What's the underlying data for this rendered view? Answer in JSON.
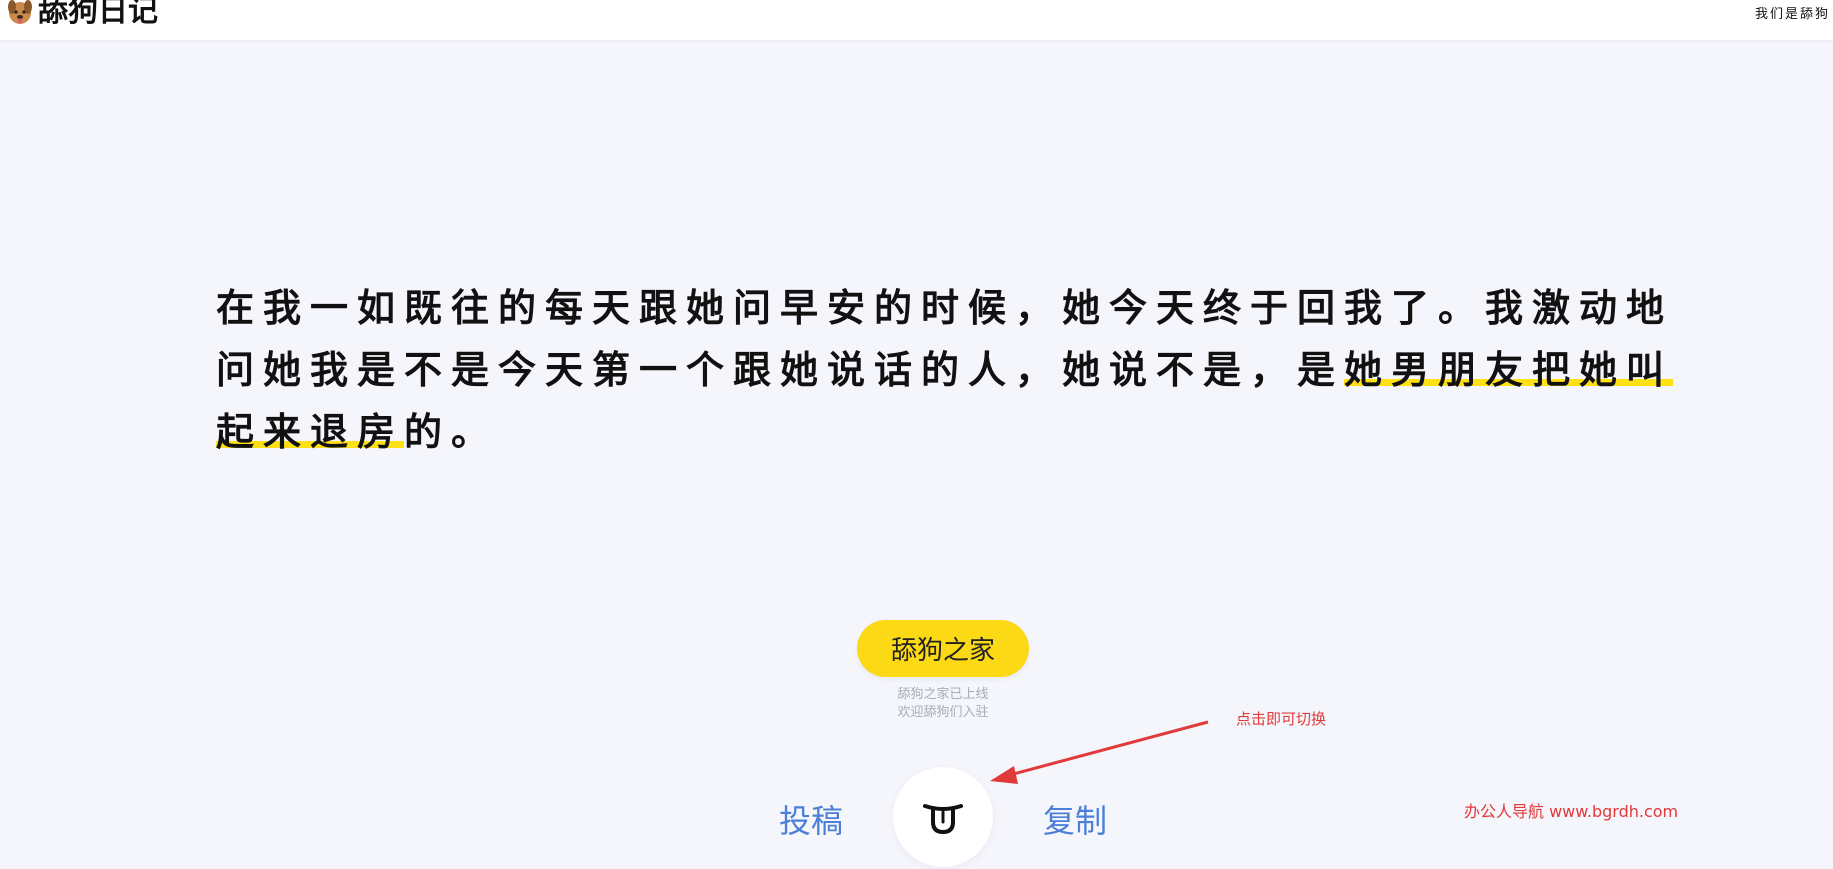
{
  "header": {
    "logo_text": "舔狗日记",
    "right_text": "我们是舔狗"
  },
  "quote": {
    "plain": "在我一如既往的每天跟她问早安的时候，她今天终于回我了。我激动地问她我是不是今天第一个跟她说话的人，她说不是，是",
    "highlighted": "她男朋友把她叫起来退房",
    "tail": "的。"
  },
  "home_button": {
    "label": "舔狗之家"
  },
  "subnote": {
    "line1": "舔狗之家已上线",
    "line2": "欢迎舔狗们入驻"
  },
  "annotation": {
    "text": "点击即可切换"
  },
  "watermark": {
    "text": "办公人导航 www.bgrdh.com"
  },
  "controls": {
    "submit_label": "投稿",
    "copy_label": "复制",
    "toggle_icon": "tongue-face-icon"
  },
  "colors": {
    "background": "#f5f5fc",
    "accent_yellow": "#fcd915",
    "link_blue": "#4c80d8",
    "annotation_red": "#e03a3a"
  }
}
